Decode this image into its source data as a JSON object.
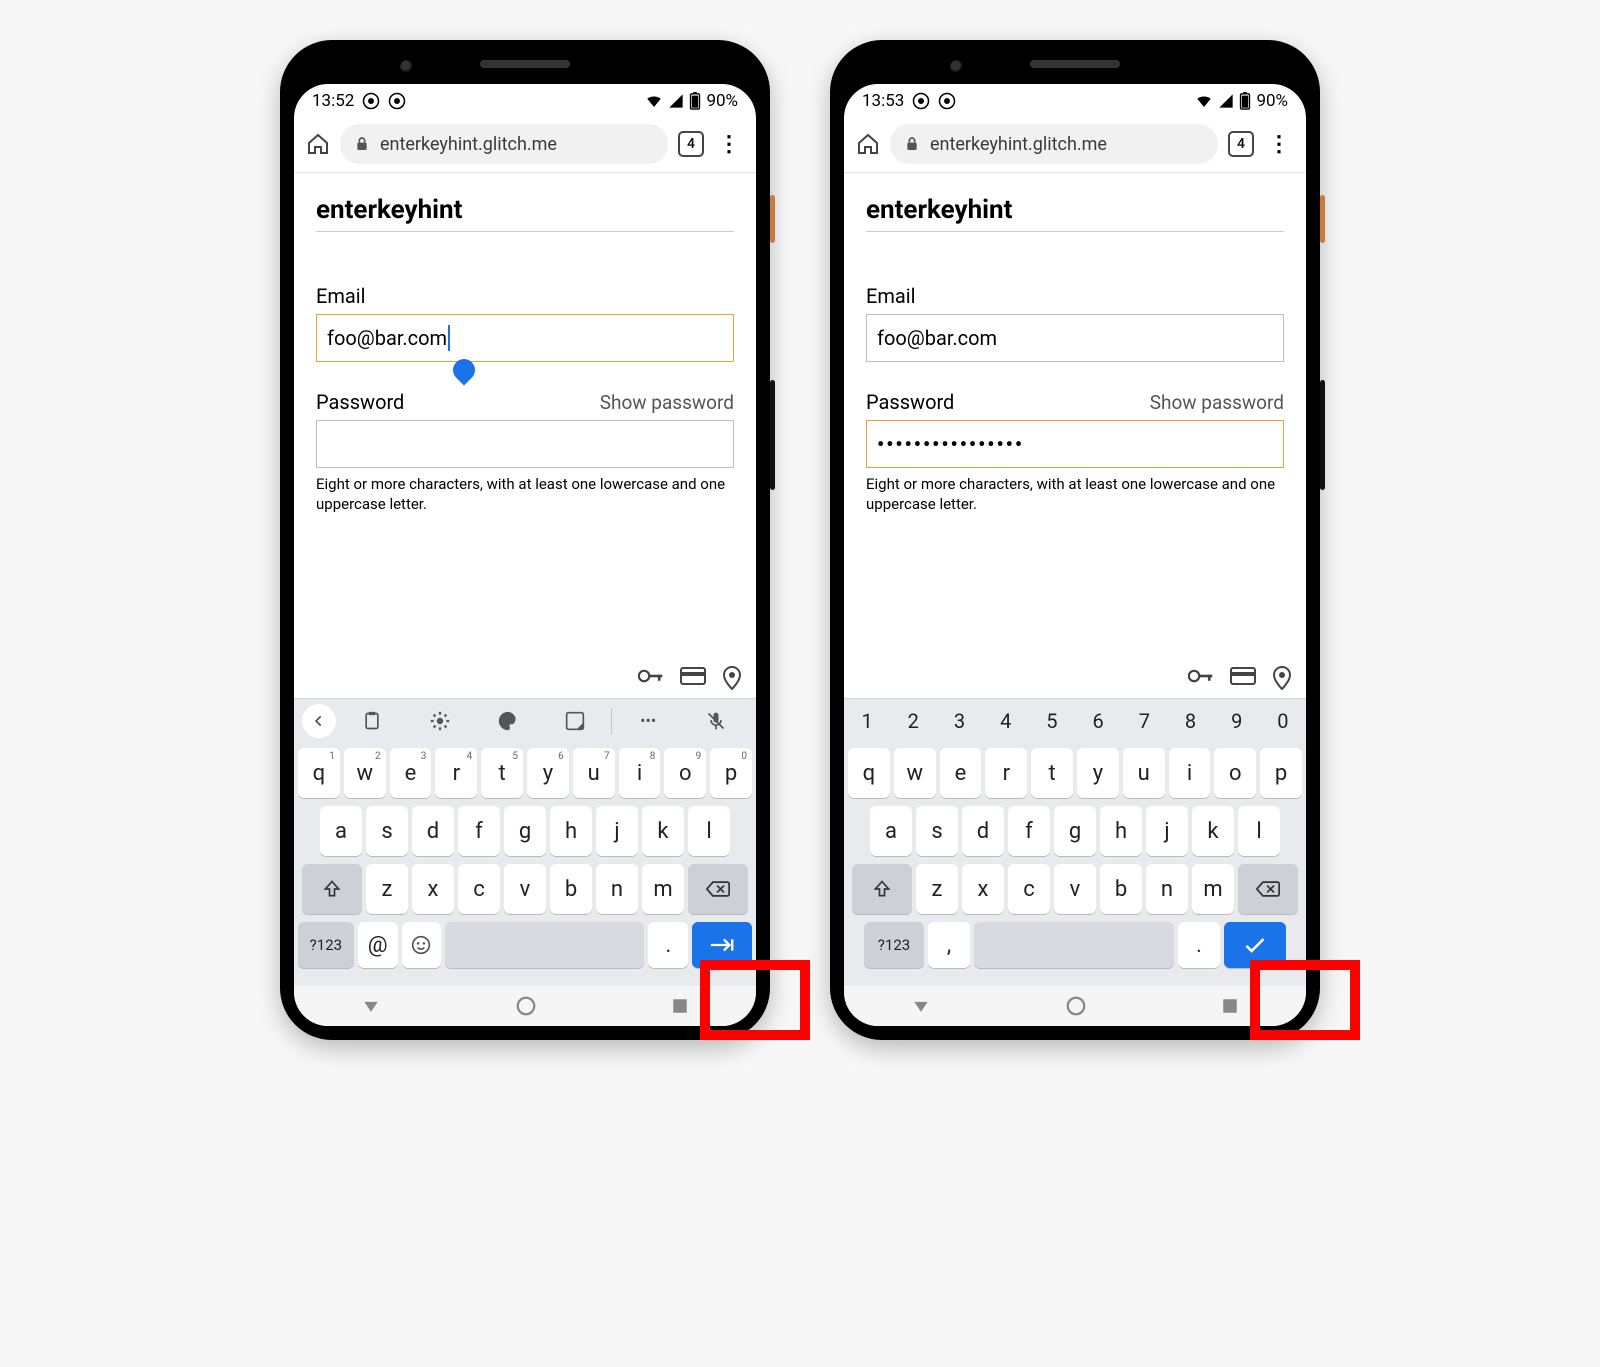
{
  "phones": [
    {
      "time": "13:52",
      "battery_pct": "90%",
      "omnibar_url": "enterkeyhint.glitch.me",
      "tab_count": "4",
      "page_title": "enterkeyhint",
      "email_label": "Email",
      "email_value": "foo@bar.com",
      "email_focused": true,
      "show_caret_teardrop": true,
      "password_label": "Password",
      "show_password_label": "Show password",
      "password_value": "",
      "password_focused": false,
      "password_hint": "Eight or more characters, with at least one lowercase and one uppercase letter.",
      "suggestion_variant": "icons",
      "number_row": [
        "1",
        "2",
        "3",
        "4",
        "5",
        "6",
        "7",
        "8",
        "9",
        "0"
      ],
      "qwerty_row1": [
        "q",
        "w",
        "e",
        "r",
        "t",
        "y",
        "u",
        "i",
        "o",
        "p"
      ],
      "row1_sup": [
        "1",
        "2",
        "3",
        "4",
        "5",
        "6",
        "7",
        "8",
        "9",
        "0"
      ],
      "qwerty_row2": [
        "a",
        "s",
        "d",
        "f",
        "g",
        "h",
        "j",
        "k",
        "l"
      ],
      "qwerty_row3": [
        "z",
        "x",
        "c",
        "v",
        "b",
        "n",
        "m"
      ],
      "sym_key": "?123",
      "bottom_extra1": "@",
      "bottom_extra2_is_emoji": true,
      "bottom_period": ".",
      "enter_key_icon": "next"
    },
    {
      "time": "13:53",
      "battery_pct": "90%",
      "omnibar_url": "enterkeyhint.glitch.me",
      "tab_count": "4",
      "page_title": "enterkeyhint",
      "email_label": "Email",
      "email_value": "foo@bar.com",
      "email_focused": false,
      "show_caret_teardrop": false,
      "password_label": "Password",
      "show_password_label": "Show password",
      "password_value": "••••••••••••••••",
      "password_focused": true,
      "password_hint": "Eight or more characters, with at least one lowercase and one uppercase letter.",
      "suggestion_variant": "numbers",
      "number_row": [
        "1",
        "2",
        "3",
        "4",
        "5",
        "6",
        "7",
        "8",
        "9",
        "0"
      ],
      "qwerty_row1": [
        "q",
        "w",
        "e",
        "r",
        "t",
        "y",
        "u",
        "i",
        "o",
        "p"
      ],
      "row1_sup": [
        "",
        "",
        "",
        "",
        "",
        "",
        "",
        "",
        "",
        ""
      ],
      "qwerty_row2": [
        "a",
        "s",
        "d",
        "f",
        "g",
        "h",
        "j",
        "k",
        "l"
      ],
      "qwerty_row3": [
        "z",
        "x",
        "c",
        "v",
        "b",
        "n",
        "m"
      ],
      "sym_key": "?123",
      "bottom_extra1": ",",
      "bottom_extra2_is_emoji": false,
      "bottom_period": ".",
      "enter_key_icon": "done"
    }
  ]
}
